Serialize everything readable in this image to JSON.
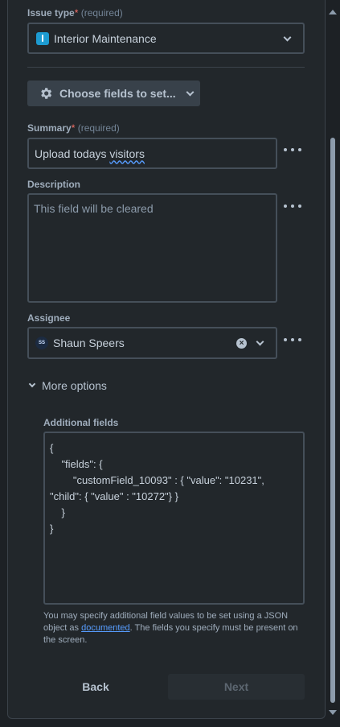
{
  "issue_type": {
    "label": "Issue type",
    "required_mark": "*",
    "required_text": "(required)",
    "value": "Interior Maintenance",
    "icon": "info-square-icon",
    "icon_color": "#1d9bd1"
  },
  "choose_fields": {
    "label": "Choose fields to set..."
  },
  "summary": {
    "label": "Summary",
    "required_mark": "*",
    "required_text": "(required)",
    "value_plain": "Upload todays ",
    "value_underlined": "visitors"
  },
  "description": {
    "label": "Description",
    "placeholder": "This field will be cleared"
  },
  "assignee": {
    "label": "Assignee",
    "avatar_initials": "SS",
    "value": "Shaun Speers"
  },
  "more_options": {
    "label": "More options"
  },
  "additional_fields": {
    "label": "Additional fields",
    "json_lines": [
      "{",
      "    \"fields\": {",
      "        \"customField_10093\" : { \"value\": \"10231\",",
      "\"child\": { \"value\" : \"10272\"} }",
      "    }",
      "}"
    ],
    "help_before": "You may specify additional field values to be set using a JSON object as ",
    "help_link": "documented",
    "help_after": ". The fields you specify must be present on the screen."
  },
  "footer": {
    "back_label": "Back",
    "next_label": "Next"
  },
  "colors": {
    "background": "#1d2125",
    "panel": "#22272b",
    "link": "#579dff",
    "required": "#f87168"
  }
}
